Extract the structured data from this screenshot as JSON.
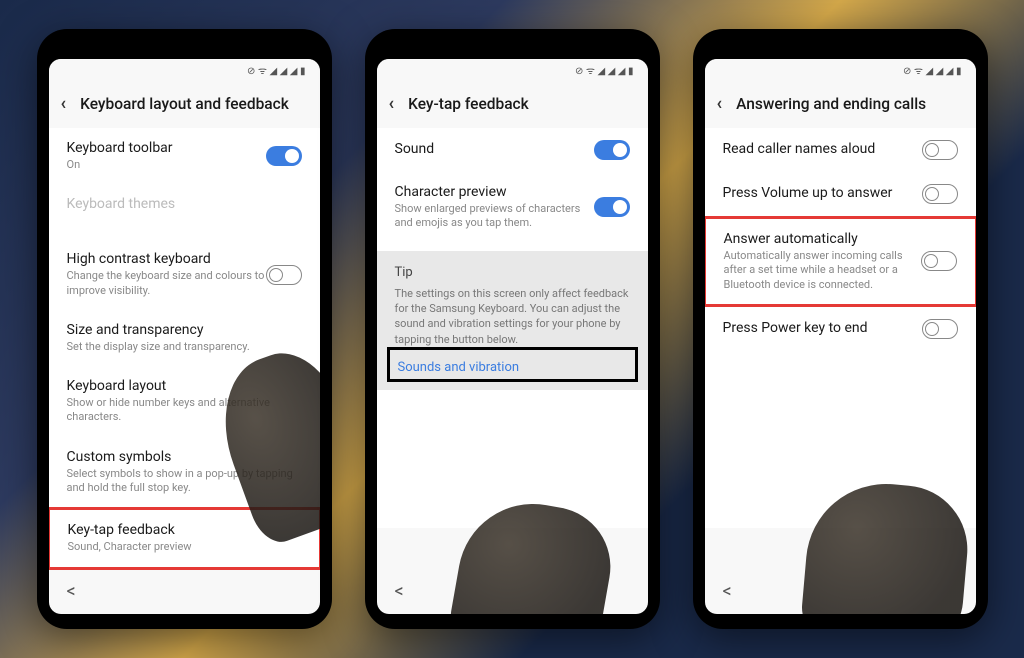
{
  "statusIcons": "⊘ ᯤ ◢ ◢ ◢ ▮",
  "phone1": {
    "header": "Keyboard layout and feedback",
    "items": {
      "kbToolbar": {
        "title": "Keyboard toolbar",
        "subtitle": "On"
      },
      "kbThemes": {
        "title": "Keyboard themes",
        "subtitle": ""
      },
      "highContrast": {
        "title": "High contrast keyboard",
        "subtitle": "Change the keyboard size and colours to improve visibility."
      },
      "sizeTrans": {
        "title": "Size and transparency",
        "subtitle": "Set the display size and transparency."
      },
      "kbLayout": {
        "title": "Keyboard layout",
        "subtitle": "Show or hide number keys and alternative characters."
      },
      "customSymbols": {
        "title": "Custom symbols",
        "subtitle": "Select symbols to show in a pop-up by tapping and hold the full stop key."
      },
      "keyTap": {
        "title": "Key-tap feedback",
        "subtitle": "Sound, Character preview"
      }
    }
  },
  "phone2": {
    "header": "Key-tap feedback",
    "sound": {
      "title": "Sound"
    },
    "charPreview": {
      "title": "Character preview",
      "subtitle": "Show enlarged previews of characters and emojis as you tap them."
    },
    "tip": {
      "title": "Tip",
      "text": "The settings on this screen only affect feedback for the Samsung Keyboard. You can adjust the sound and vibration settings for your phone by tapping the button below.",
      "link": "Sounds and vibration"
    }
  },
  "phone3": {
    "header": "Answering and ending calls",
    "readCaller": {
      "title": "Read caller names aloud"
    },
    "pressVolume": {
      "title": "Press Volume up to answer"
    },
    "answerAuto": {
      "title": "Answer automatically",
      "subtitle": "Automatically answer incoming calls after a set time while a headset or a Bluetooth device is connected."
    },
    "pressPower": {
      "title": "Press Power key to end"
    }
  }
}
